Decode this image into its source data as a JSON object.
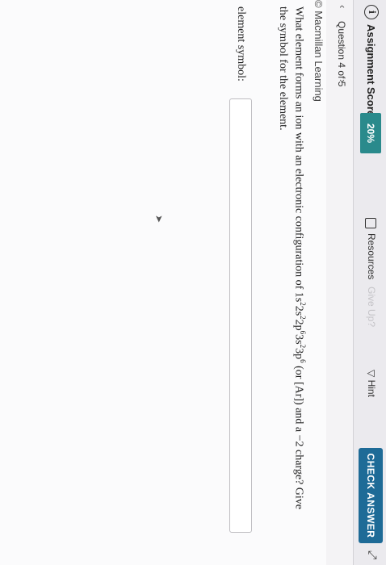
{
  "header": {
    "score_label": "Assignment Score:",
    "score_value": "20%",
    "resources_label": "Resources",
    "give_up_label": "Give Up?",
    "hint_label": "Hint",
    "check_answer_label": "Check Answer"
  },
  "question_nav": {
    "label": "Question 4 of 5"
  },
  "content": {
    "brand": "© Macmillan Learning",
    "question_prefix": "What element forms an ion with an electronic configuration of 1s",
    "question_suffix": "(or [Ar]) and a −2 charge? Give the symbol for the element.",
    "field_label": "element symbol:",
    "field_value": ""
  }
}
